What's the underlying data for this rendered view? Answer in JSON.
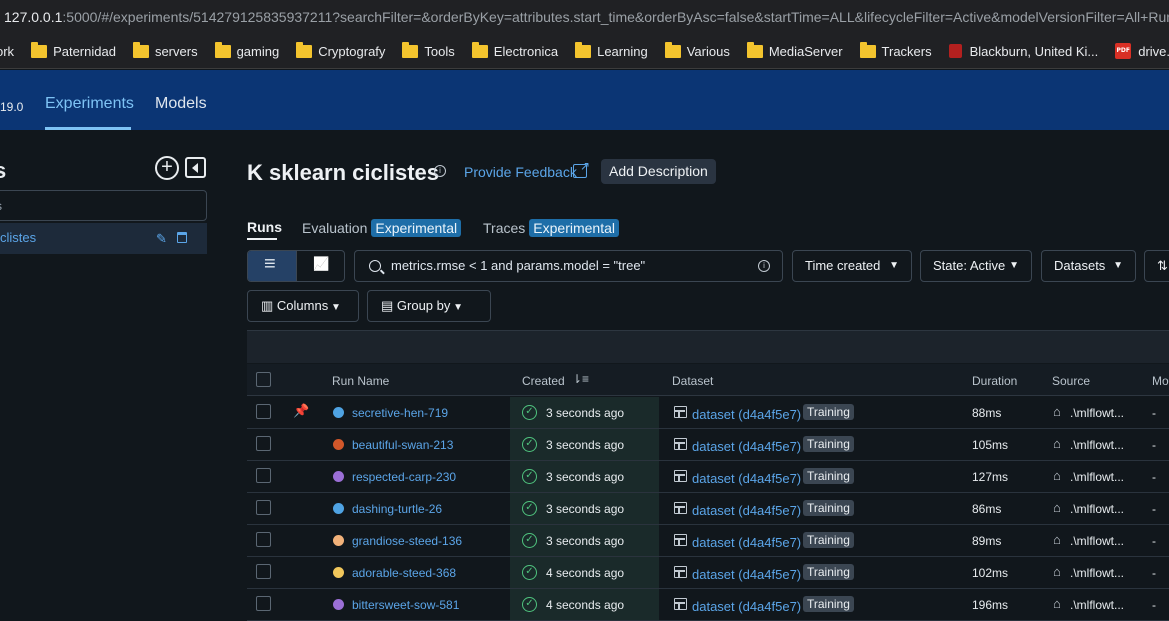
{
  "browser": {
    "url_host": "127.0.0.1",
    "url_rest": ":5000/#/experiments/514279125835937211?searchFilter=&orderByKey=attributes.start_time&orderByAsc=false&startTime=ALL&lifecycleFilter=Active&modelVersionFilter=All+Run",
    "bookmarks": [
      {
        "label": "ork",
        "icon": "none"
      },
      {
        "label": "Paternidad",
        "icon": "folder"
      },
      {
        "label": "servers",
        "icon": "folder"
      },
      {
        "label": "gaming",
        "icon": "folder"
      },
      {
        "label": "Cryptografy",
        "icon": "folder"
      },
      {
        "label": "Tools",
        "icon": "folder"
      },
      {
        "label": "Electronica",
        "icon": "folder"
      },
      {
        "label": "Learning",
        "icon": "folder"
      },
      {
        "label": "Various",
        "icon": "folder"
      },
      {
        "label": "MediaServer",
        "icon": "folder"
      },
      {
        "label": "Trackers",
        "icon": "folder"
      },
      {
        "label": "Blackburn, United Ki...",
        "icon": "red-favicon"
      },
      {
        "label": "drive.google.com",
        "icon": "pdf"
      }
    ]
  },
  "topnav": {
    "version": "19.0",
    "tab_experiments": "Experiments",
    "tab_models": "Models"
  },
  "sidebar": {
    "title": "s",
    "search_placeholder": "s",
    "selected_item": "clistes"
  },
  "header": {
    "title": "K sklearn ciclistes",
    "feedback": "Provide Feedback",
    "add_description": "Add Description"
  },
  "tabs": {
    "runs": "Runs",
    "evaluation": "Evaluation",
    "evaluation_badge": "Experimental",
    "traces": "Traces",
    "traces_badge": "Experimental"
  },
  "toolbar": {
    "search_value": "metrics.rmse < 1 and params.model = \"tree\"",
    "time_created": "Time created",
    "state": "State: Active",
    "datasets": "Datasets",
    "columns": "Columns",
    "group_by": "Group by"
  },
  "table": {
    "headers": {
      "run_name": "Run Name",
      "created": "Created",
      "dataset": "Dataset",
      "duration": "Duration",
      "source": "Source",
      "models": "Mo"
    },
    "rows": [
      {
        "name": "secretive-hen-719",
        "color": "#4fa3e3",
        "created": "3 seconds ago",
        "dataset": "dataset (d4a4f5e7)",
        "tag": "Training",
        "duration": "88ms",
        "source": ".\\mlflowt...",
        "models": "-"
      },
      {
        "name": "beautiful-swan-213",
        "color": "#d2572a",
        "created": "3 seconds ago",
        "dataset": "dataset (d4a4f5e7)",
        "tag": "Training",
        "duration": "105ms",
        "source": ".\\mlflowt...",
        "models": "-"
      },
      {
        "name": "respected-carp-230",
        "color": "#9b6fd6",
        "created": "3 seconds ago",
        "dataset": "dataset (d4a4f5e7)",
        "tag": "Training",
        "duration": "127ms",
        "source": ".\\mlflowt...",
        "models": "-"
      },
      {
        "name": "dashing-turtle-26",
        "color": "#4fa3e3",
        "created": "3 seconds ago",
        "dataset": "dataset (d4a4f5e7)",
        "tag": "Training",
        "duration": "86ms",
        "source": ".\\mlflowt...",
        "models": "-"
      },
      {
        "name": "grandiose-steed-136",
        "color": "#f2b27a",
        "created": "3 seconds ago",
        "dataset": "dataset (d4a4f5e7)",
        "tag": "Training",
        "duration": "89ms",
        "source": ".\\mlflowt...",
        "models": "-"
      },
      {
        "name": "adorable-steed-368",
        "color": "#f1c75b",
        "created": "4 seconds ago",
        "dataset": "dataset (d4a4f5e7)",
        "tag": "Training",
        "duration": "102ms",
        "source": ".\\mlflowt...",
        "models": "-"
      },
      {
        "name": "bittersweet-sow-581",
        "color": "#9b6fd6",
        "created": "4 seconds ago",
        "dataset": "dataset (d4a4f5e7)",
        "tag": "Training",
        "duration": "196ms",
        "source": ".\\mlflowt...",
        "models": "-"
      }
    ]
  }
}
